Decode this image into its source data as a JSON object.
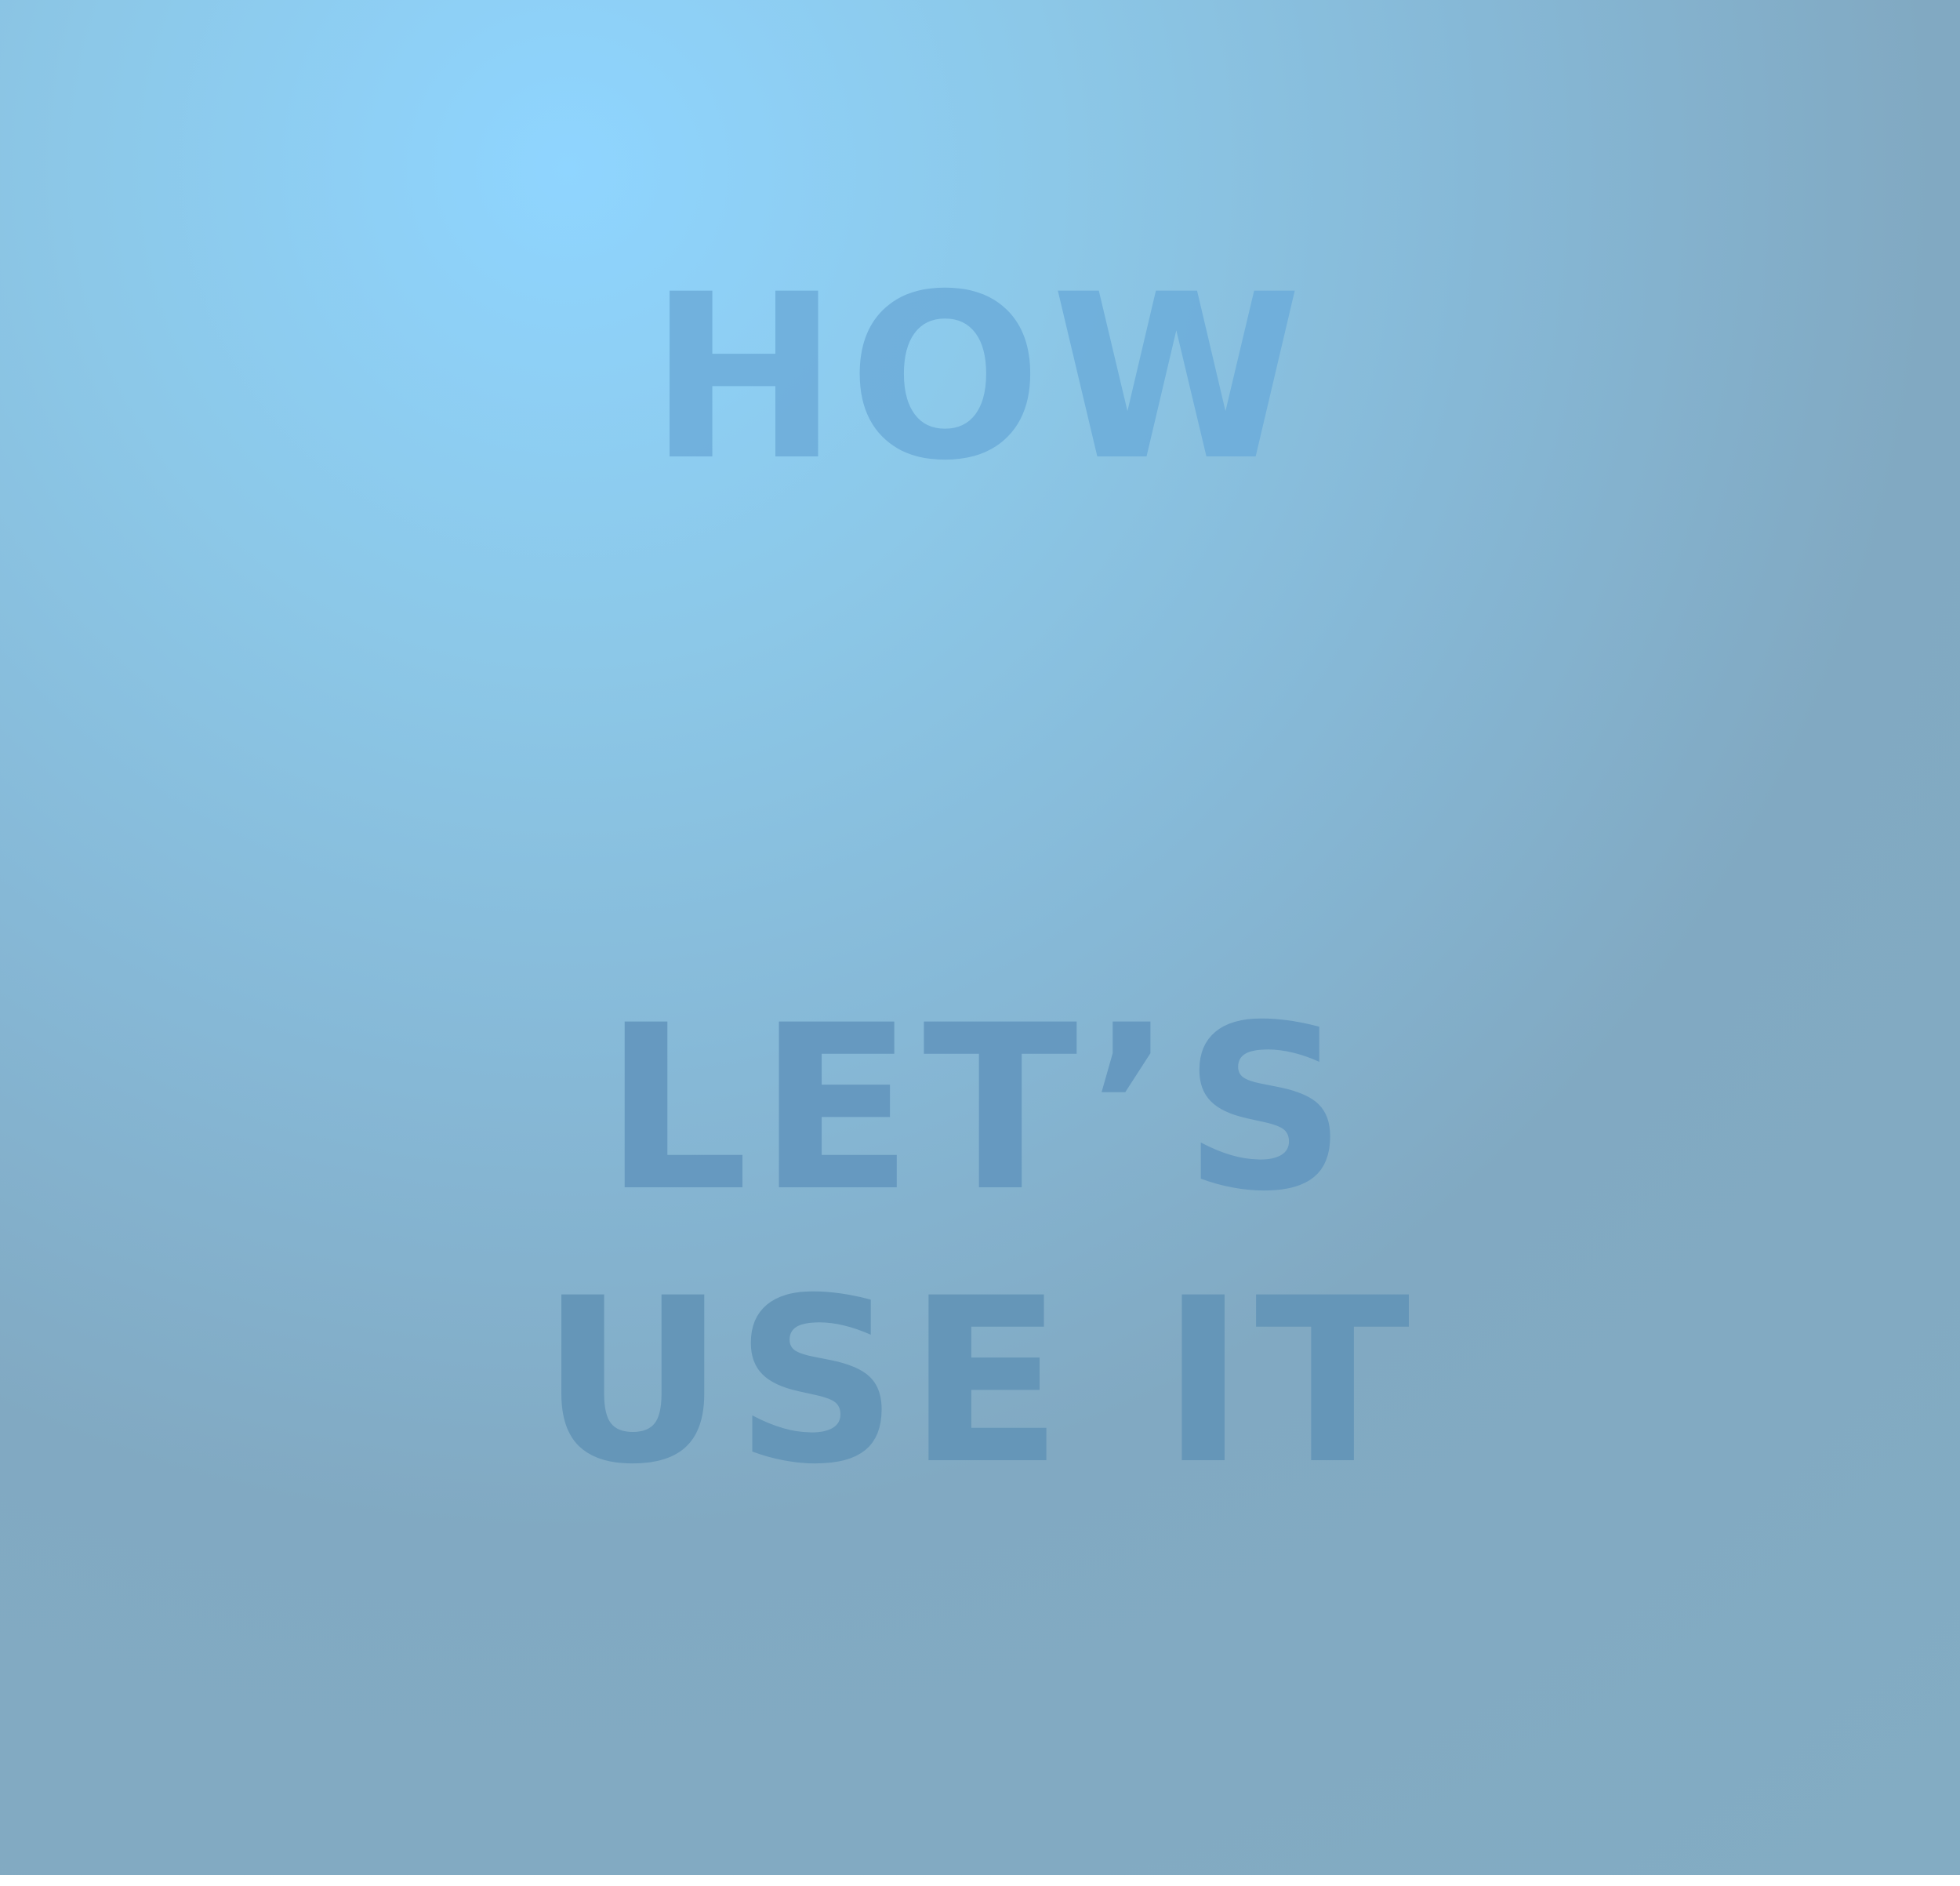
{
  "slide": {
    "line1": "HOW",
    "line2": "LET’S",
    "line3": "USE IT"
  },
  "colors": {
    "background_light": "#8fd5ff",
    "background_dark": "#81a9c2",
    "text_top": "#6eaedb",
    "text_bottom": "#6596b8",
    "scallop_edge": "#ffffff"
  }
}
